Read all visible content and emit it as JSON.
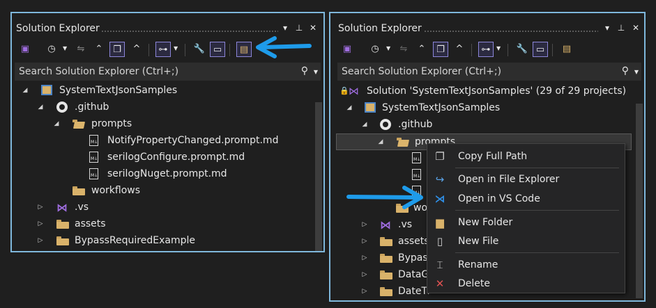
{
  "left_panel": {
    "title": "Solution Explorer",
    "search_placeholder": "Search Solution Explorer (Ctrl+;)",
    "tree": [
      {
        "label": "SystemTextJsonSamples",
        "icon": "project-icon"
      },
      {
        "label": ".github",
        "icon": "github-icon"
      },
      {
        "label": "prompts",
        "icon": "folder-open-icon"
      },
      {
        "label": "NotifyPropertyChanged.prompt.md",
        "icon": "markdown-file-icon"
      },
      {
        "label": "serilogConfigure.prompt.md",
        "icon": "markdown-file-icon"
      },
      {
        "label": "serilogNuget.prompt.md",
        "icon": "markdown-file-icon"
      },
      {
        "label": "workflows",
        "icon": "folder-icon"
      },
      {
        "label": ".vs",
        "icon": "visual-studio-icon"
      },
      {
        "label": "assets",
        "icon": "folder-icon"
      },
      {
        "label": "BypassRequiredExample",
        "icon": "folder-icon"
      }
    ]
  },
  "right_panel": {
    "title": "Solution Explorer",
    "search_placeholder": "Search Solution Explorer (Ctrl+;)",
    "tree": [
      {
        "label": "Solution 'SystemTextJsonSamples' (29 of 29 projects)",
        "icon": "solution-icon"
      },
      {
        "label": "SystemTextJsonSamples",
        "icon": "project-icon"
      },
      {
        "label": ".github",
        "icon": "github-icon"
      },
      {
        "label": "prompts",
        "icon": "folder-open-icon"
      },
      {
        "label": "",
        "icon": "markdown-file-icon"
      },
      {
        "label": "",
        "icon": "markdown-file-icon"
      },
      {
        "label": "",
        "icon": "markdown-file-icon"
      },
      {
        "label": "wo",
        "icon": "folder-icon"
      },
      {
        "label": ".vs",
        "icon": "visual-studio-icon"
      },
      {
        "label": "assets",
        "icon": "folder-icon"
      },
      {
        "label": "Bypass",
        "icon": "folder-icon"
      },
      {
        "label": "DataG",
        "icon": "folder-icon"
      },
      {
        "label": "DateTi",
        "icon": "folder-icon"
      }
    ]
  },
  "context_menu": {
    "items": [
      {
        "label": "Copy Full Path",
        "icon": "copy-icon"
      },
      {
        "label": "Open in File Explorer",
        "icon": "open-folder-arrow-icon"
      },
      {
        "label": "Open in VS Code",
        "icon": "vscode-icon"
      },
      {
        "label": "New Folder",
        "icon": "new-folder-icon"
      },
      {
        "label": "New File",
        "icon": "new-file-icon"
      },
      {
        "label": "Rename",
        "icon": "rename-icon"
      },
      {
        "label": "Delete",
        "icon": "delete-icon"
      }
    ]
  },
  "colors": {
    "background": "#1f1f1f",
    "panel_border": "#7fb8dc",
    "annotation_arrow": "#1e9bea",
    "active_button_border": "#8c86d9",
    "folder": "#d9b26a",
    "delete_icon": "#e05252",
    "vscode_icon": "#2f8fe6"
  }
}
